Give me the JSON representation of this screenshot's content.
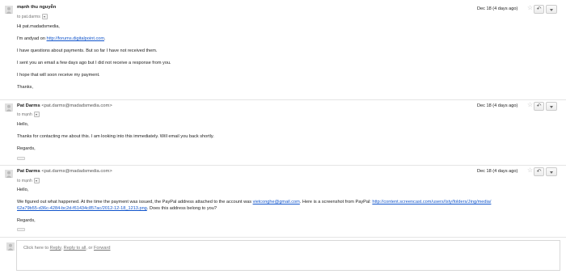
{
  "messages": [
    {
      "sender": "mạnh thu nguyễn",
      "sender_email": "",
      "to": "to pat.darms",
      "date": "Dec 18 (4 days ago)",
      "lines": {
        "l1": "Hi pat.madadsmedia,",
        "l2_prefix": "I'm andyad on ",
        "l2_link": "http://forums.digitalpoint.com",
        "l2_suffix": ".",
        "l3": "I have questions about payments. But so far I have not received them.",
        "l4": "I sent you an email a few days ago but I did not receive a response from you.",
        "l5": "I hope that will soon receive my payment.",
        "l6": "Thanks,"
      }
    },
    {
      "sender": "Pat Darms",
      "sender_email": "<pat.darms@madadsmedia.com>",
      "to": "to mạnh",
      "date": "Dec 18 (4 days ago)",
      "lines": {
        "l1": "Hello,",
        "l2": "Thanks for contacting me about this.  I am looking into this immediately.  Will email you back shortly.",
        "l3": "Regards,"
      }
    },
    {
      "sender": "Pat Darms",
      "sender_email": "<pat.darms@madadsmedia.com>",
      "to": "to mạnh",
      "date": "Dec 18 (4 days ago)",
      "lines": {
        "l1": "Hello,",
        "l2_a": "We figured out what happened.  At the time the payment was issued, the PayPal address attached to the account was ",
        "l2_link1": "vietconghe@gmail.com",
        "l2_b": ".   Here is a screenshot from PayPal: ",
        "l2_link2": "http://content.screencast.com/users/Isty/folders/Jing/media/",
        "l3_link": "62a79b55-d36c-4284-bc2d-f61434c857ac/2012-12-18_1213.png",
        "l3_b": ".  Does this address belong to you?",
        "l4": "Regards,"
      }
    }
  ],
  "reply_box": {
    "prefix": "Click here to ",
    "reply": "Reply",
    "sep1": ", ",
    "reply_all": "Reply to all",
    "sep2": ", or ",
    "forward": "Forward"
  },
  "icons": {
    "star": "star-icon",
    "reply": "reply-arrow-icon",
    "more": "chevron-down-icon",
    "avatar": "person-silhouette-icon"
  },
  "colors": {
    "link": "#1155cc",
    "divider": "#e5e5e5",
    "muted": "#777777"
  }
}
